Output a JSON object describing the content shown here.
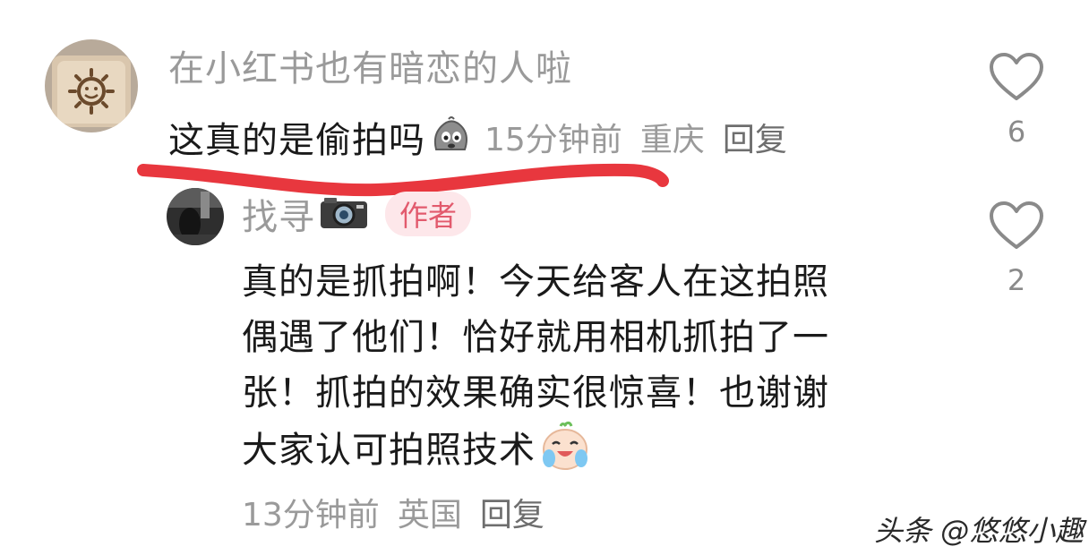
{
  "comment": {
    "username": "在小红书也有暗恋的人啦",
    "text": "这真的是偷拍吗",
    "emoji": "crying-rock-emoji",
    "time": "15分钟前",
    "location": "重庆",
    "reply_label": "回复",
    "likes": "6"
  },
  "reply": {
    "username": "找寻",
    "icon": "camera-icon",
    "badge": "作者",
    "lines": [
      "真的是抓拍啊！今天给客人在这拍照",
      "偶遇了他们！恰好就用相机抓拍了一",
      "张！抓拍的效果确实很惊喜！也谢谢",
      "大家认可拍照技术"
    ],
    "emoji": "laughing-crying-emoji",
    "time": "13分钟前",
    "location": "英国",
    "reply_label": "回复",
    "likes": "2"
  },
  "watermark": "头条 @悠悠小趣",
  "colors": {
    "underline": "#e8373e",
    "badge_bg": "#fde7ea",
    "badge_text": "#e25a6d",
    "muted": "#9a9a9a"
  }
}
